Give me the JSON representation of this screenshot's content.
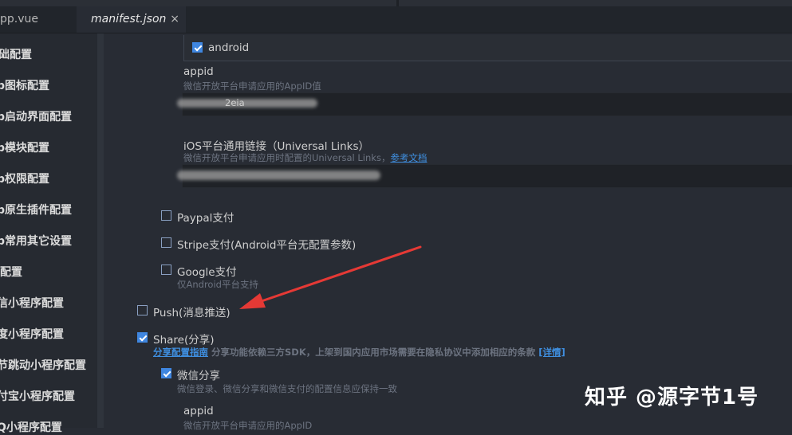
{
  "tabs": [
    {
      "label": "pp.vue"
    },
    {
      "label": "manifest.json",
      "close": "×"
    }
  ],
  "sidebar": {
    "items": [
      "础配置",
      "p图标配置",
      "p启动界面配置",
      "p模块配置",
      "p权限配置",
      "p原生插件配置",
      "p常用其它设置",
      "配置",
      "信小程序配置",
      "度小程序配置",
      "节跳动小程序配置",
      "付宝小程序配置",
      "Q小程序配置"
    ]
  },
  "main": {
    "android": {
      "label": "android",
      "checked": true
    },
    "appid_1": {
      "label": "appid",
      "hint": "微信开放平台申请应用的AppID值",
      "value_partial": "2eia"
    },
    "universal_links": {
      "label": "iOS平台通用链接（Universal Links）",
      "hint": "微信开放平台申请应用时配置的Universal Links，",
      "link": "参考文档"
    },
    "paypal": {
      "label": "Paypal支付",
      "checked": false
    },
    "stripe": {
      "label": "Stripe支付(Android平台无配置参数)",
      "checked": false
    },
    "google": {
      "label": "Google支付",
      "hint": "仅Android平台支持",
      "checked": false
    },
    "push": {
      "label": "Push(消息推送)",
      "checked": false
    },
    "share": {
      "label": "Share(分享)",
      "checked": true,
      "hint_link": "分享配置指南",
      "hint_text": "分享功能依赖三方SDK，上架到国内应用市场需要在隐私协议中添加相应的条款",
      "detail_link": "[详情]"
    },
    "wechat_share": {
      "label": "微信分享",
      "checked": true,
      "hint": "微信登录、微信分享和微信支付的配置信息应保持一致"
    },
    "appid_2": {
      "label": "appid",
      "hint": "微信开放平台申请应用的AppID"
    }
  },
  "watermark": "知乎 @源字节1号",
  "colors": {
    "accent": "#3f86e0",
    "arrow": "#e53935",
    "background": "#282c34"
  }
}
